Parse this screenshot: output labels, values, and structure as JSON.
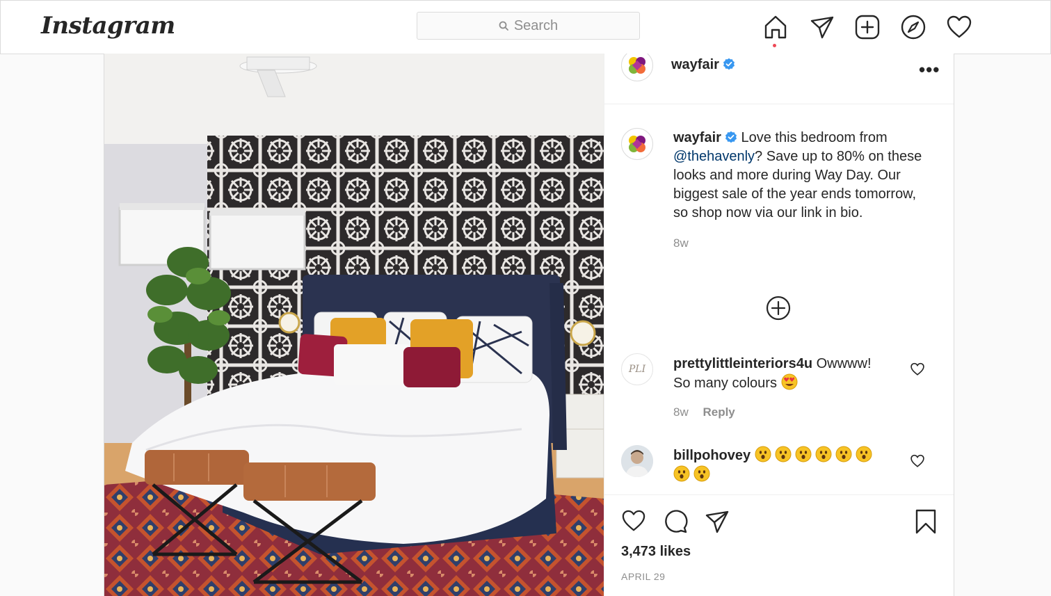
{
  "app": {
    "brand": "Instagram"
  },
  "search": {
    "placeholder": "Search"
  },
  "nav": {
    "icons": [
      "home-icon",
      "direct-icon",
      "new-post-icon",
      "explore-icon",
      "activity-icon"
    ]
  },
  "post": {
    "account": {
      "username": "wayfair",
      "verified": true
    },
    "caption": {
      "username": "wayfair",
      "text_1": "Love this bedroom from",
      "mention": "@thehavenly",
      "text_2": "? Save up to 80% on these looks and more during Way Day. Our biggest sale of the year ends tomorrow, so shop now via our link in bio.",
      "time": "8w"
    },
    "comments": [
      {
        "username": "prettylittleinteriors4u",
        "text": "Owwww! So many colours",
        "time": "8w",
        "reply_label": "Reply",
        "avatar_text": "PLI"
      },
      {
        "username": "billpohovey",
        "text": ""
      }
    ],
    "likes": "3,473 likes",
    "date": "APRIL 29"
  },
  "colors": {
    "accent_blue": "#0095f6",
    "mention": "#00376b",
    "muted": "#8e8e8e",
    "notification_dot": "#ed4956"
  }
}
